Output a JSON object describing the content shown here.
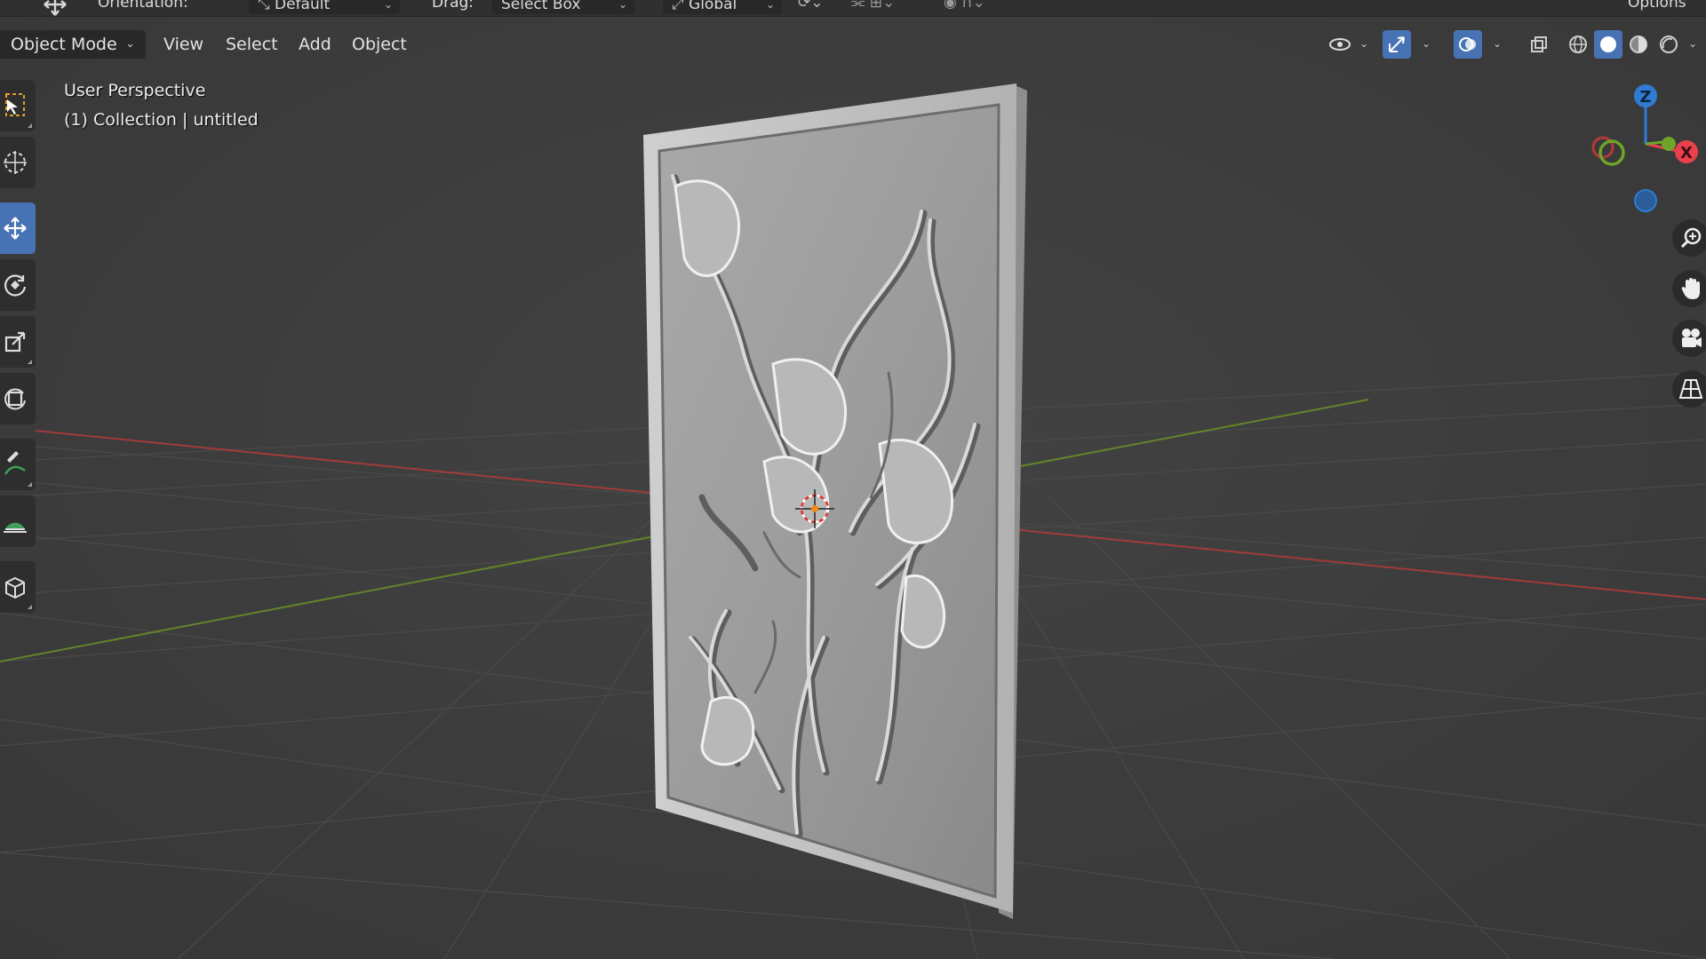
{
  "topbar": {
    "orientation_label": "Orientation:",
    "orientation_value": "Default",
    "drag_label": "Drag:",
    "drag_value": "Select Box",
    "transform_space": "Global",
    "options_label": "Options"
  },
  "header": {
    "mode": "Object Mode",
    "menus": [
      "View",
      "Select",
      "Add",
      "Object"
    ]
  },
  "viewport_info": {
    "line1": "User Perspective",
    "line2": "(1) Collection | untitled"
  },
  "gizmo": {
    "z_label": "Z",
    "x_label": "X",
    "colors": {
      "x": "#e8414c",
      "y": "#6ea52a",
      "z": "#2f7cd4"
    }
  },
  "toolbar_tools": [
    "select-box",
    "cursor",
    "move",
    "rotate",
    "scale",
    "transform",
    "annotate",
    "measure",
    "add-cube"
  ],
  "right_nav": [
    "zoom-icon",
    "pan-hand-icon",
    "camera-icon",
    "ortho-grid-icon"
  ],
  "colors": {
    "accent": "#4772b3",
    "background": "#3d3d3d",
    "panel": "#282828",
    "x_axis": "#c63c3c",
    "y_axis": "#6f9a2c"
  }
}
